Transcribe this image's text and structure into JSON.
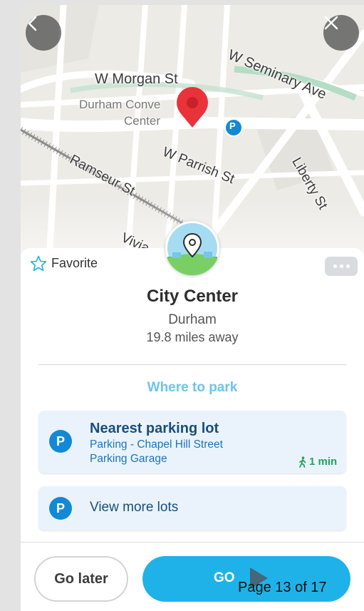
{
  "map": {
    "streets": {
      "w_morgan": "W Morgan St",
      "w_seminary": "W Seminary Ave",
      "convention_line1": "Durham Conve",
      "convention_line2": "Center",
      "w_parrish": "W Parrish St",
      "ramseur": "Ramseur St",
      "liberty": "Liberty St",
      "vivian": "Vivia"
    },
    "parking_marker": "P",
    "back_icon": "chevron-left-icon",
    "close_icon": "close-icon",
    "pin_icon": "map-pin-icon"
  },
  "card": {
    "favorite_label": "Favorite",
    "favorite_icon": "star-outline-icon",
    "more_icon": "more-dots-icon",
    "place_name": "City Center",
    "place_city": "Durham",
    "distance": "19.8 miles away",
    "where_to_park": "Where to park",
    "nearest_lot": {
      "badge": "P",
      "title": "Nearest parking lot",
      "address_line1": "Parking - Chapel Hill Street",
      "address_line2": "Parking Garage",
      "walk_icon": "walking-person-icon",
      "walk_time": "1 min"
    },
    "more_lots": {
      "badge": "P",
      "label": "View more lots"
    }
  },
  "actions": {
    "go_later": "Go later",
    "go": "GO"
  },
  "page_indicator": "Page 13 of 17",
  "colors": {
    "accent_blue": "#1fb2e8",
    "heading_blue": "#6cc4ea",
    "parking_blue": "#1389d6",
    "walk_green": "#22a35b",
    "pin_red": "#e8333b"
  }
}
